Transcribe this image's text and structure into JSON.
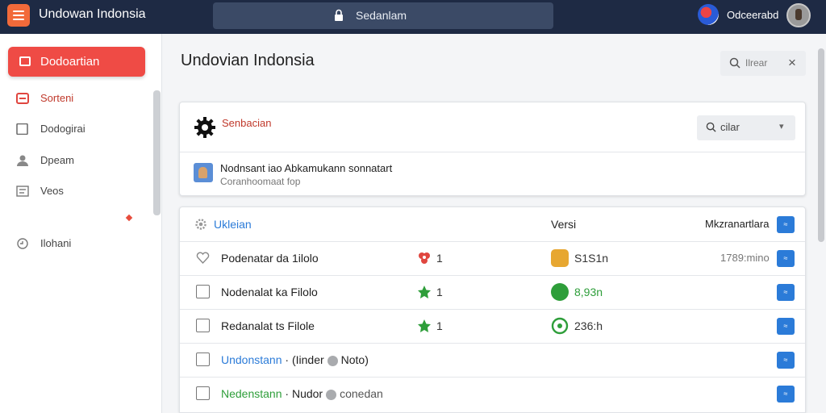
{
  "header": {
    "app_title": "Undowan Indonsia",
    "search_label": "Sedanlam",
    "user_name": "Odceerabd"
  },
  "sidebar": {
    "active_item": "Dodoartian",
    "items": [
      {
        "label": "Sorteni"
      },
      {
        "label": "Dodogirai"
      },
      {
        "label": "Dpeam"
      },
      {
        "label": "Veos"
      },
      {
        "label": "Ilohani"
      }
    ]
  },
  "main": {
    "title": "Undovian Indonsia",
    "filter_placeholder": "Ilrear",
    "close_symbol": "×"
  },
  "section_card": {
    "title": "Senbacian",
    "select_value": "cilar",
    "notice_title": "Nodnsant iao Abkamukann sonnatart",
    "notice_subtitle": "Coranhoomaat fop"
  },
  "table": {
    "headers": [
      "Ukleian",
      "Versi",
      "Mkzranartlara"
    ],
    "action_label": "≈",
    "rows": [
      {
        "name": "Podenatar da 1ilolo",
        "count": "1",
        "version": "S1S1n",
        "time": "1789:mino",
        "icon1": "red-flower-icon",
        "icon2": "gold-badge-icon"
      },
      {
        "name": "Nodenalat ka Filolo",
        "count": "1",
        "version": "8,93n",
        "time": "",
        "icon1": "green-star-icon",
        "icon2": "green-check-icon"
      },
      {
        "name": "Redanalat ts Filole",
        "count": "1",
        "version": "236:h",
        "time": "",
        "icon1": "green-star-icon",
        "icon2": "green-refresh-icon"
      },
      {
        "name": "Undonstann",
        "suffix": "· (Iinder",
        "tag": "Noto)",
        "time": ""
      },
      {
        "name": "Nedenstann",
        "suffix": "· Nudor",
        "tag": "conedan",
        "time": ""
      }
    ]
  },
  "colors": {
    "topbar": "#1e2a44",
    "accent_red": "#ef4b45",
    "accent_blue": "#2b7bd8",
    "accent_green": "#2e9e3a"
  }
}
